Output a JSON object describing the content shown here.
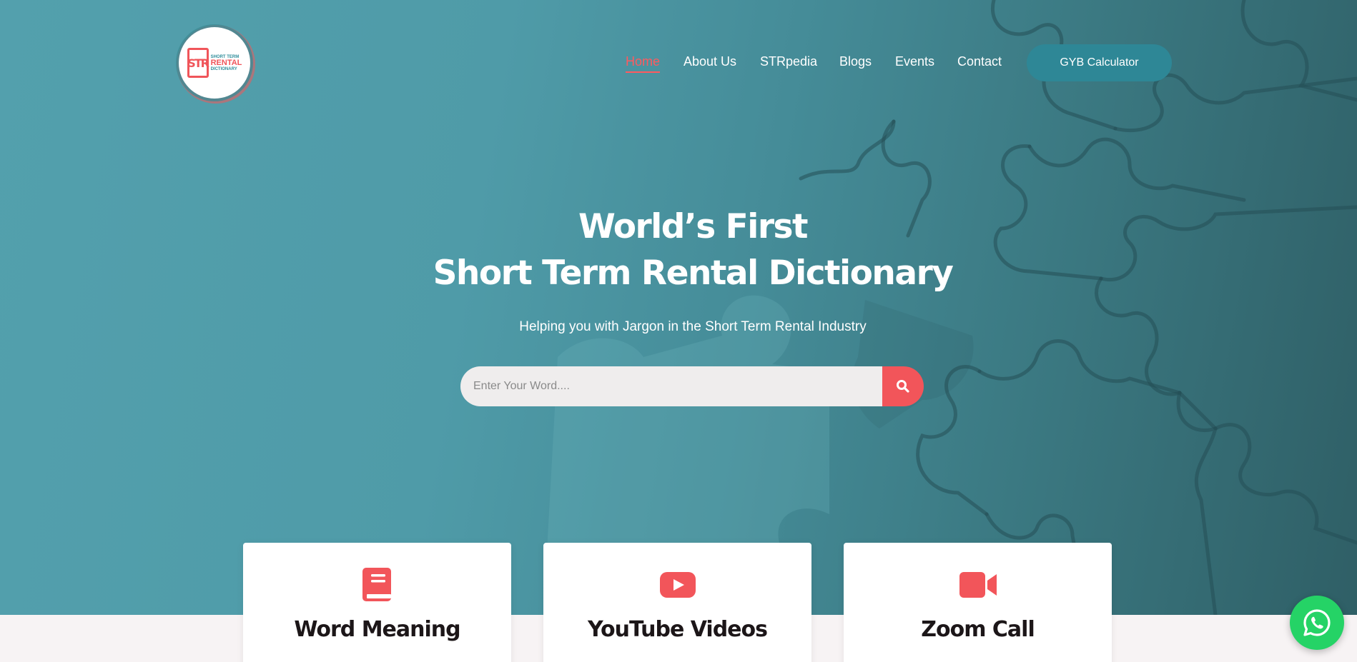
{
  "header": {
    "logo_alt": "Short Term Rental Dictionary",
    "logo_lines": [
      "SHORT TERM",
      "RENTAL",
      "DICTIONARY"
    ],
    "logo_mark": "STR",
    "nav": [
      {
        "label": "Home",
        "active": true
      },
      {
        "label": "About Us",
        "active": false
      },
      {
        "label": "STRpedia",
        "active": false
      },
      {
        "label": "Blogs",
        "active": false
      },
      {
        "label": "Events",
        "active": false
      },
      {
        "label": "Contact",
        "active": false
      }
    ],
    "cta_label": "GYB Calculator"
  },
  "hero": {
    "title_line1": "World’s First",
    "title_line2": "Short Term Rental Dictionary",
    "subtitle": "Helping you with Jargon in the Short Term Rental Industry",
    "search_placeholder": "Enter Your Word....",
    "search_value": ""
  },
  "cards": [
    {
      "title": "Word Meaning",
      "icon": "book-icon"
    },
    {
      "title": "YouTube Videos",
      "icon": "youtube-icon"
    },
    {
      "title": "Zoom Call",
      "icon": "video-camera-icon"
    }
  ],
  "floating": {
    "icon": "whatsapp-icon"
  },
  "colors": {
    "accent": "#ff5a5f",
    "teal": "#2e8796",
    "hero_start": "#53a0ad",
    "hero_end": "#2f5f66",
    "whatsapp": "#25d366",
    "card_title": "#1c1618"
  }
}
